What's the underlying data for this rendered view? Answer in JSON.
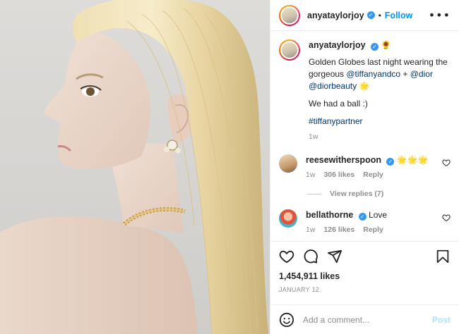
{
  "post": {
    "author": "anyataylorjoy",
    "follow_label": "Follow",
    "separator": "•",
    "more_glyph": "•••",
    "verified_glyph": "✓"
  },
  "caption": {
    "username": "anyataylorjoy",
    "emoji": "🌻",
    "line1_text": "Golden Globes last night wearing the gorgeous ",
    "mention_tiffany": "@tiffanyandco",
    "plus": " + ",
    "mention_dior": "@dior",
    "mention_diorbeauty": "@diorbeauty",
    "sparkle": " 🌟",
    "line2": "We had a ball :)",
    "hashtag": "#tiffanypartner",
    "time": "1w"
  },
  "comments": [
    {
      "username": "reesewitherspoon",
      "text": "🌟🌟🌟",
      "time": "1w",
      "likes": "306 likes",
      "reply": "Reply"
    },
    {
      "username": "bellathorne",
      "text": "Love",
      "time": "1w",
      "likes": "126 likes",
      "reply": "Reply"
    }
  ],
  "view_replies": "View replies (7)",
  "likes_count": "1,454,911 likes",
  "date": "JANUARY 12",
  "add_comment": {
    "placeholder": "Add a comment...",
    "post_label": "Post"
  },
  "colors": {
    "accent_blue": "#0095f6",
    "verified_blue": "#3897f0",
    "link_blue": "#00376b",
    "muted": "#8e8e8e",
    "post_disabled": "#b2dffc"
  },
  "icons": [
    "more-options-icon",
    "verified-icon",
    "heart-icon",
    "comment-icon",
    "share-icon",
    "bookmark-icon",
    "emoji-icon"
  ]
}
